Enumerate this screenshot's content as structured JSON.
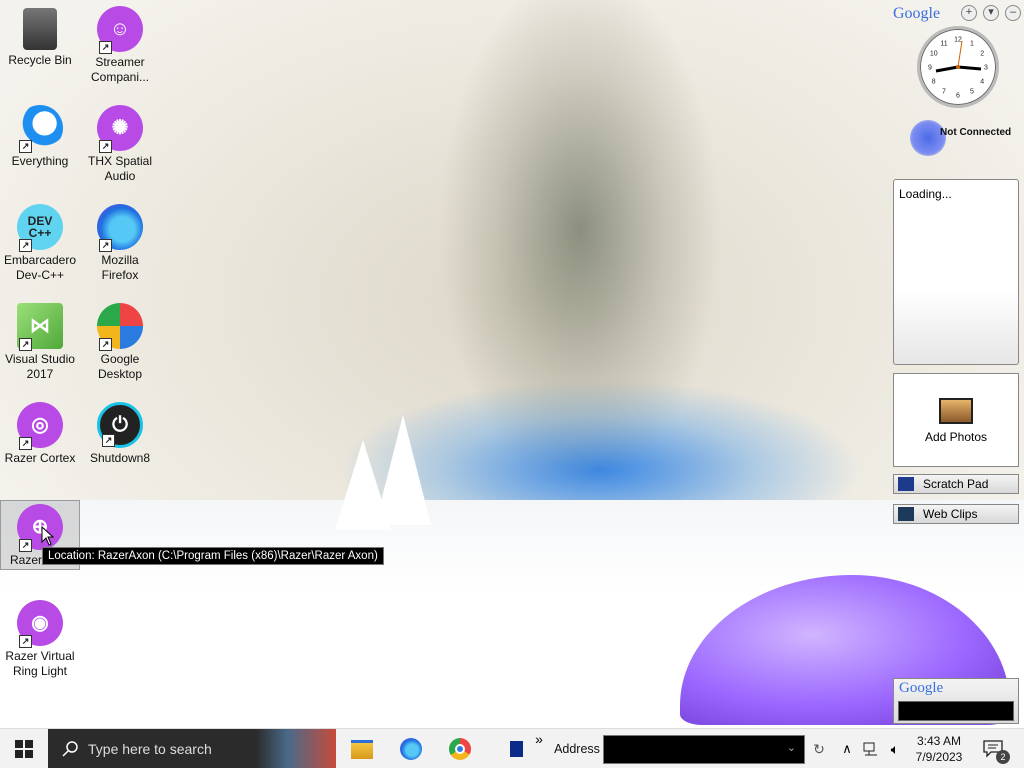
{
  "desktop": {
    "icons": [
      {
        "label_line1": "Recycle Bin",
        "label_line2": "",
        "icon": "recycle-bin-icon"
      },
      {
        "label_line1": "Streamer",
        "label_line2": "Compani...",
        "icon": "streamer-companion-icon"
      },
      {
        "label_line1": "Everything",
        "label_line2": "",
        "icon": "everything-search-icon"
      },
      {
        "label_line1": "THX Spatial",
        "label_line2": "Audio",
        "icon": "thx-spatial-audio-icon"
      },
      {
        "label_line1": "Embarcadero",
        "label_line2": "Dev-C++",
        "icon": "devcpp-icon"
      },
      {
        "label_line1": "Mozilla",
        "label_line2": "Firefox",
        "icon": "firefox-icon"
      },
      {
        "label_line1": "Visual Studio",
        "label_line2": "2017",
        "icon": "visual-studio-icon"
      },
      {
        "label_line1": "Google",
        "label_line2": "Desktop",
        "icon": "google-desktop-icon"
      },
      {
        "label_line1": "Razer Cortex",
        "label_line2": "",
        "icon": "razer-cortex-icon"
      },
      {
        "label_line1": "Shutdown8",
        "label_line2": "",
        "icon": "shutdown-icon"
      },
      {
        "label_line1": "Razer",
        "label_line2": "",
        "icon": "razer-axon-icon"
      },
      {
        "label_line1": "Razer Virtual",
        "label_line2": "Ring Light",
        "icon": "razer-ring-light-icon"
      }
    ],
    "tooltip": "Location: RazerAxon (C:\\Program Files (x86)\\Razer\\Razer Axon)",
    "devcpp_glyph": "DEV C++"
  },
  "sidebar": {
    "google_logo": "Google",
    "add_btn": "+",
    "menu_btn": "▾",
    "min_btn": "–",
    "network_status": "Not Connected",
    "news_loading": "Loading...",
    "photos_label": "Add Photos",
    "scratch_pad": "Scratch Pad",
    "web_clips": "Web Clips",
    "search_logo": "Google",
    "clock_numbers": [
      "12",
      "1",
      "2",
      "3",
      "4",
      "5",
      "6",
      "7",
      "8",
      "9",
      "10",
      "11"
    ]
  },
  "taskbar": {
    "search_placeholder": "Type here to search",
    "address_label": "Address",
    "address_value": "",
    "chevron": "»",
    "time": "3:43 AM",
    "date": "7/9/2023",
    "notification_count": "2"
  },
  "colors": {
    "taskbar_bg": "#f2f2f2",
    "search_bg": "#2b2b2b",
    "accent_purple": "#b84be6"
  }
}
